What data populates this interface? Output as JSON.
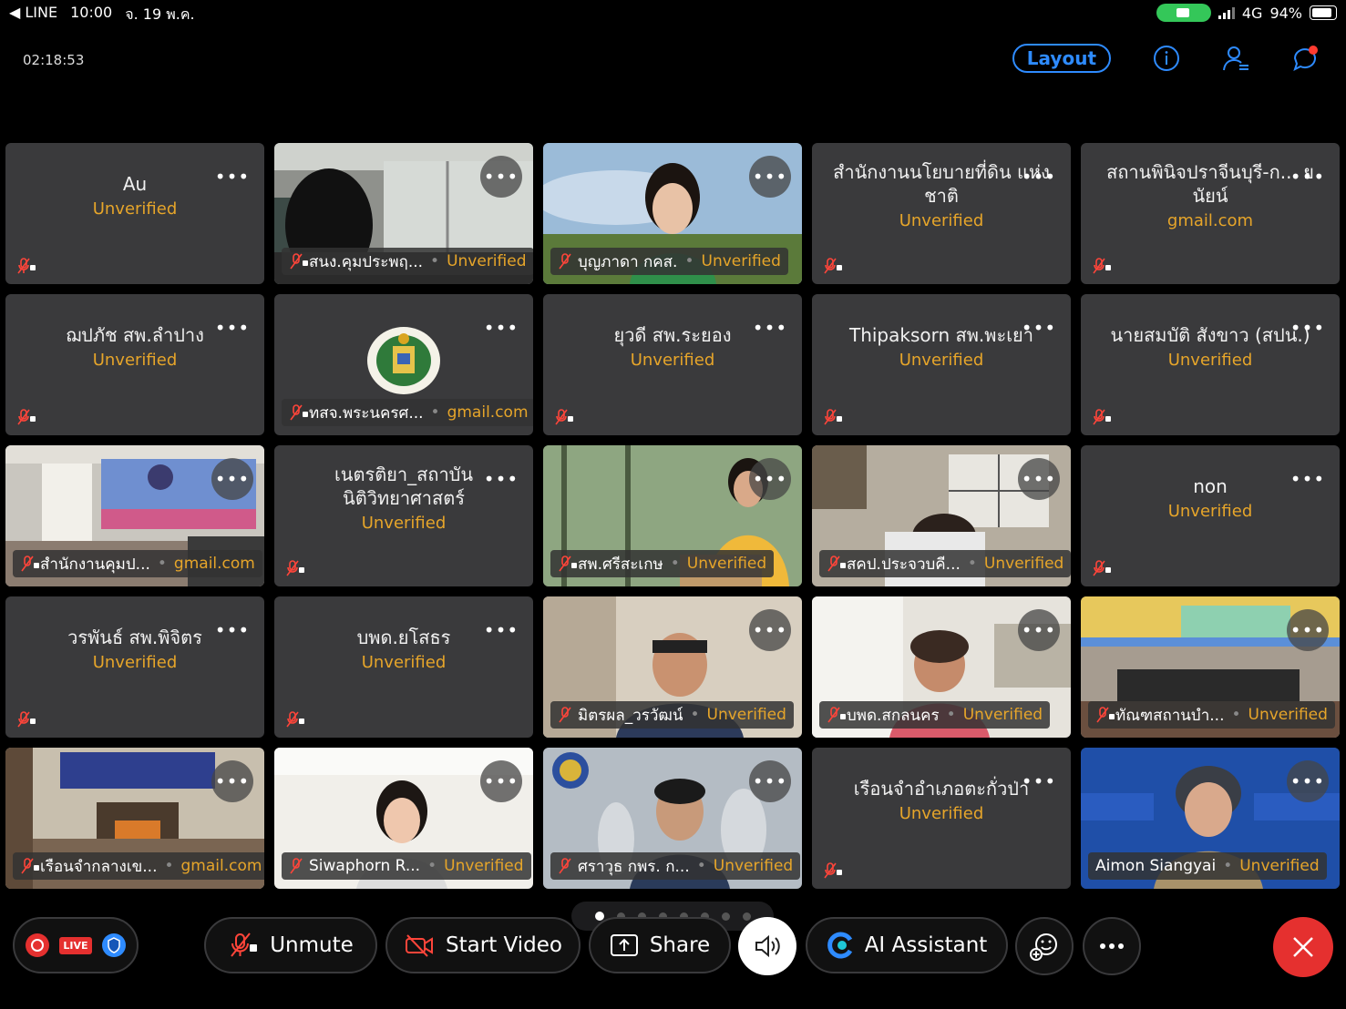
{
  "status_bar": {
    "back_app": "LINE",
    "time": "10:00",
    "date": "จ. 19 พ.ค.",
    "network": "4G",
    "battery": "94%"
  },
  "meeting": {
    "elapsed": "02:18:53",
    "layout_label": "Layout"
  },
  "tiles": [
    {
      "name": "Au",
      "status": "Unverified"
    },
    {
      "name": "สนง.คุมประพฤ...",
      "status": "Unverified"
    },
    {
      "name": "บุญภาดา กคส.",
      "status": "Unverified"
    },
    {
      "name": "สำนักงานนโยบายที่ดิน แห่งชาติ",
      "status": "Unverified"
    },
    {
      "name": "สถานพินิจปราจีนบุรี-ก... ยนัยน์",
      "status": "gmail.com"
    },
    {
      "name": "ฌปภัช สพ.ลำปาง",
      "status": "Unverified"
    },
    {
      "name": "ทสจ.พระนครศ...",
      "status": "gmail.com"
    },
    {
      "name": "ยุวดี สพ.ระยอง",
      "status": "Unverified"
    },
    {
      "name": "Thipaksorn สพ.พะเยา",
      "status": "Unverified"
    },
    {
      "name": "นายสมบัติ สังขาว (สปน.)",
      "status": "Unverified"
    },
    {
      "name": "สำนักงานคุมป...",
      "status": "gmail.com"
    },
    {
      "name": "เนตรติยา_สถาบัน นิติวิทยาศาสตร์",
      "status": "Unverified"
    },
    {
      "name": "สพ.ศรีสะเกษ",
      "status": "Unverified"
    },
    {
      "name": "สคป.ประจวบคี...",
      "status": "Unverified"
    },
    {
      "name": "non",
      "status": "Unverified"
    },
    {
      "name": "วรพันธ์ สพ.พิจิตร",
      "status": "Unverified"
    },
    {
      "name": "บพด.ยโสธร",
      "status": "Unverified"
    },
    {
      "name": "มิตรผล_วรวัฒน์",
      "status": "Unverified"
    },
    {
      "name": "บพด.สกลนคร",
      "status": "Unverified"
    },
    {
      "name": "ทัณฑสถานบำ...",
      "status": "Unverified"
    },
    {
      "name": "เรือนจำกลางเข...",
      "status": "gmail.com"
    },
    {
      "name": "Siwaphorn R...",
      "status": "Unverified"
    },
    {
      "name": "ศราวุธ กพร. ก...",
      "status": "Unverified"
    },
    {
      "name": "เรือนจำอำเภอตะกั่วป่า",
      "status": "Unverified"
    },
    {
      "name": "Aimon Siangyai",
      "status": "Unverified"
    }
  ],
  "toolbar": {
    "live_label": "LIVE",
    "unmute": "Unmute",
    "start_video": "Start Video",
    "share": "Share",
    "ai_assistant": "AI Assistant"
  },
  "colors": {
    "accent": "#2e8bff",
    "unverified": "#e6a52a",
    "leave": "#e5302f",
    "tile": "#3a3a3c"
  }
}
